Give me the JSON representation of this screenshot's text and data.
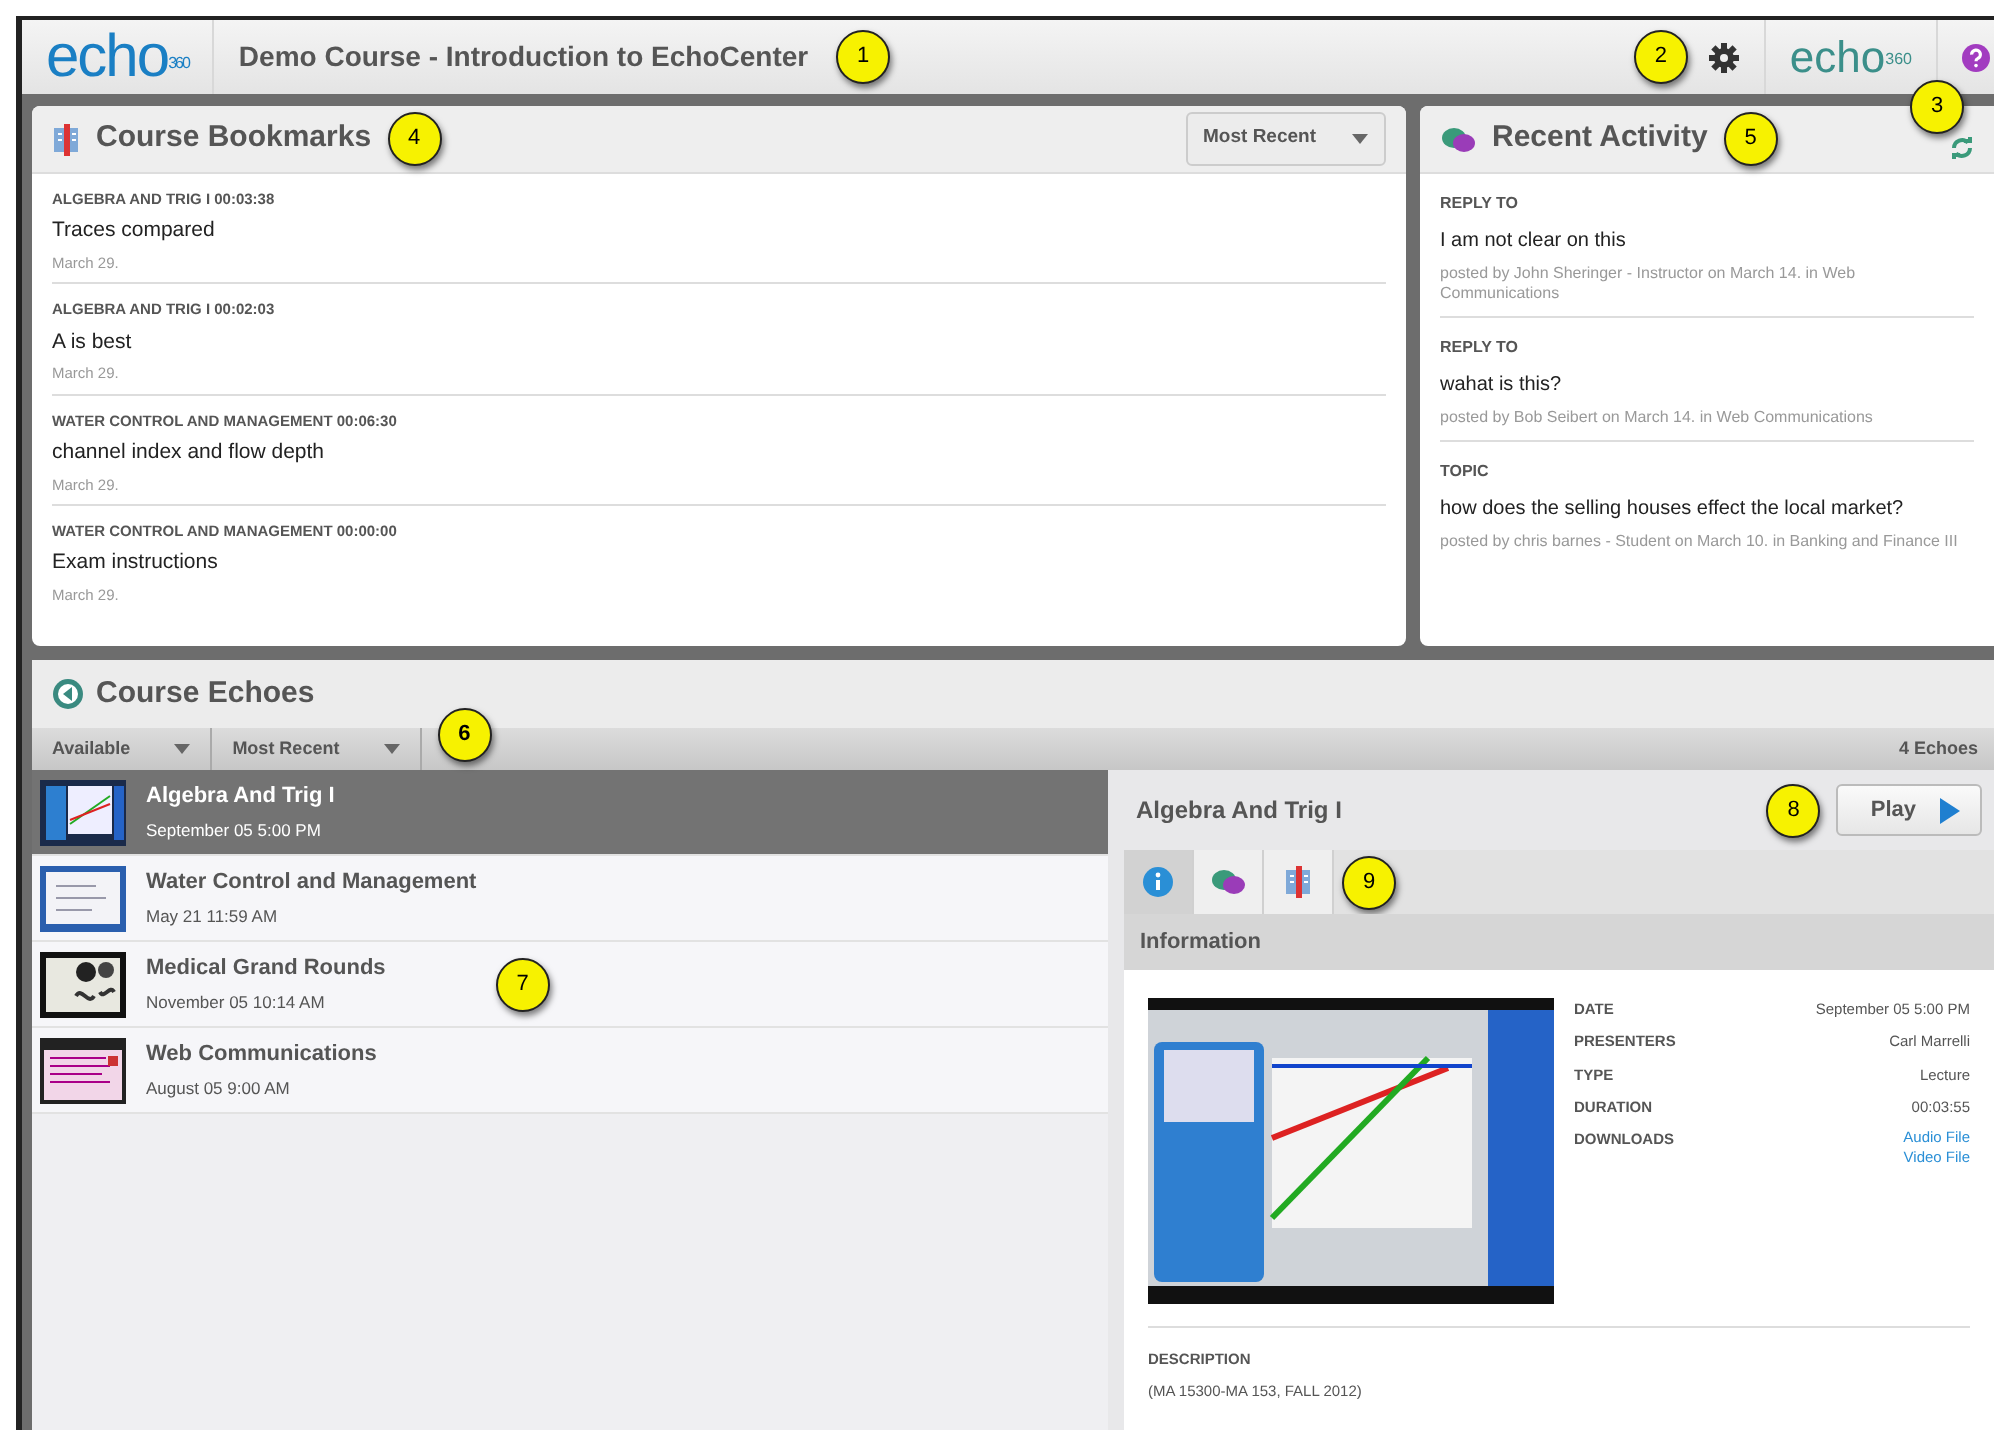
{
  "header": {
    "logo_text": "echo",
    "logo_superscript": "360",
    "title": "Demo Course - Introduction to EchoCenter",
    "title_callout": "1",
    "settings_callout": "2",
    "brand_text": "echo",
    "brand_superscript": "360",
    "help_callout": "3"
  },
  "bookmarks": {
    "title": "Course Bookmarks",
    "callout": "4",
    "sort": "Most Recent",
    "items": [
      {
        "heading": "ALGEBRA AND TRIG I 00:03:38",
        "text": "Traces compared",
        "date": "March 29."
      },
      {
        "heading": "ALGEBRA AND TRIG I 00:02:03",
        "text": "A is best",
        "date": "March 29."
      },
      {
        "heading": "WATER CONTROL AND MANAGEMENT 00:06:30",
        "text": "channel index and flow depth",
        "date": "March 29."
      },
      {
        "heading": "WATER CONTROL AND MANAGEMENT 00:00:00",
        "text": "Exam instructions",
        "date": "March 29."
      }
    ]
  },
  "activity": {
    "title": "Recent Activity",
    "callout": "5",
    "items": [
      {
        "type": "REPLY TO",
        "text": "I am not clear on this",
        "meta": "posted by John Sheringer - Instructor on March 14. in Web Communications"
      },
      {
        "type": "REPLY TO",
        "text": "wahat is this?",
        "meta": "posted by Bob Seibert on March 14. in Web Communications"
      },
      {
        "type": "TOPIC",
        "text": "how does the selling houses effect the local market?",
        "meta": "posted by chris barnes - Student on March 10. in Banking and Finance III"
      }
    ]
  },
  "echoes": {
    "title": "Course Echoes",
    "filters": [
      "Available",
      "Most Recent"
    ],
    "filters_callout": "6",
    "count": "4 Echoes",
    "list_callout": "7",
    "items": [
      {
        "title": "Algebra And Trig I",
        "date": "September 05 5:00 PM",
        "selected": true
      },
      {
        "title": "Water Control and Management",
        "date": "May 21 11:59 AM",
        "selected": false
      },
      {
        "title": "Medical Grand Rounds",
        "date": "November 05 10:14 AM",
        "selected": false
      },
      {
        "title": "Web Communications",
        "date": "August 05 9:00 AM",
        "selected": false
      }
    ]
  },
  "detail": {
    "title": "Algebra And Trig I",
    "play": "Play",
    "play_callout": "8",
    "tabs": [
      {
        "kind": "info",
        "selected": true
      },
      {
        "kind": "discussion",
        "selected": false
      },
      {
        "kind": "bookmarks",
        "selected": false
      }
    ],
    "tabs_callout": "9",
    "section": "Information",
    "fields": [
      {
        "label": "DATE",
        "value": "September 05 5:00 PM"
      },
      {
        "label": "PRESENTERS",
        "value": "Carl Marrelli"
      },
      {
        "label": "TYPE",
        "value": "Lecture"
      },
      {
        "label": "DURATION",
        "value": "00:03:55"
      },
      {
        "label": "DOWNLOADS",
        "links": [
          "Audio File",
          "Video File"
        ]
      }
    ],
    "description_label": "DESCRIPTION",
    "description": "(MA 15300-MA 153, FALL 2012)"
  }
}
